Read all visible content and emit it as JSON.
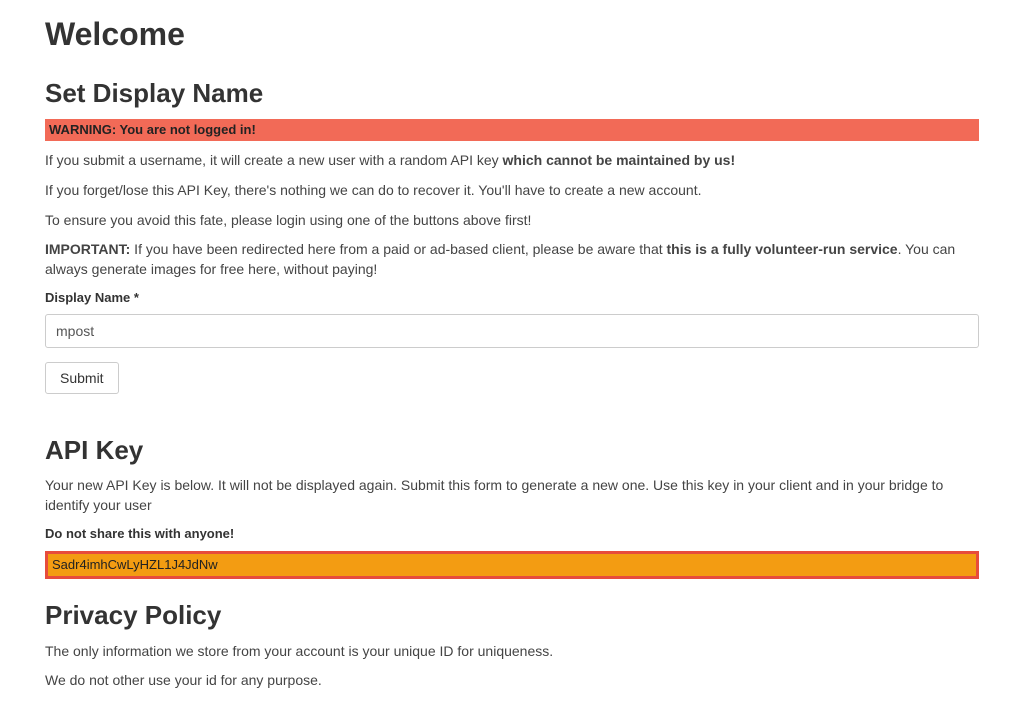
{
  "welcome": {
    "title": "Welcome"
  },
  "displayName": {
    "heading": "Set Display Name",
    "warning": "WARNING: You are not logged in!",
    "p1_before": "If you submit a username, it will create a new user with a random API key ",
    "p1_bold": "which cannot be maintained by us!",
    "p2": "If you forget/lose this API Key, there's nothing we can do to recover it. You'll have to create a new account.",
    "p3": "To ensure you avoid this fate, please login using one of the buttons above first!",
    "p4_boldlabel": "IMPORTANT:",
    "p4_mid": " If you have been redirected here from a paid or ad-based client, please be aware that ",
    "p4_bold2": "this is a fully volunteer-run service",
    "p4_after": ". You can always generate images for free here, without paying!",
    "field_label": "Display Name *",
    "field_value": "mpost",
    "submit_label": "Submit"
  },
  "apiKey": {
    "heading": "API Key",
    "desc": "Your new API Key is below. It will not be displayed again. Submit this form to generate a new one. Use this key in your client and in your bridge to identify your user",
    "no_share": "Do not share this with anyone!",
    "key_value": "Sadr4imhCwLyHZL1J4JdNw"
  },
  "privacy": {
    "heading": "Privacy Policy",
    "p1": "The only information we store from your account is your unique ID for uniqueness.",
    "p2": "We do not other use your id for any purpose."
  }
}
